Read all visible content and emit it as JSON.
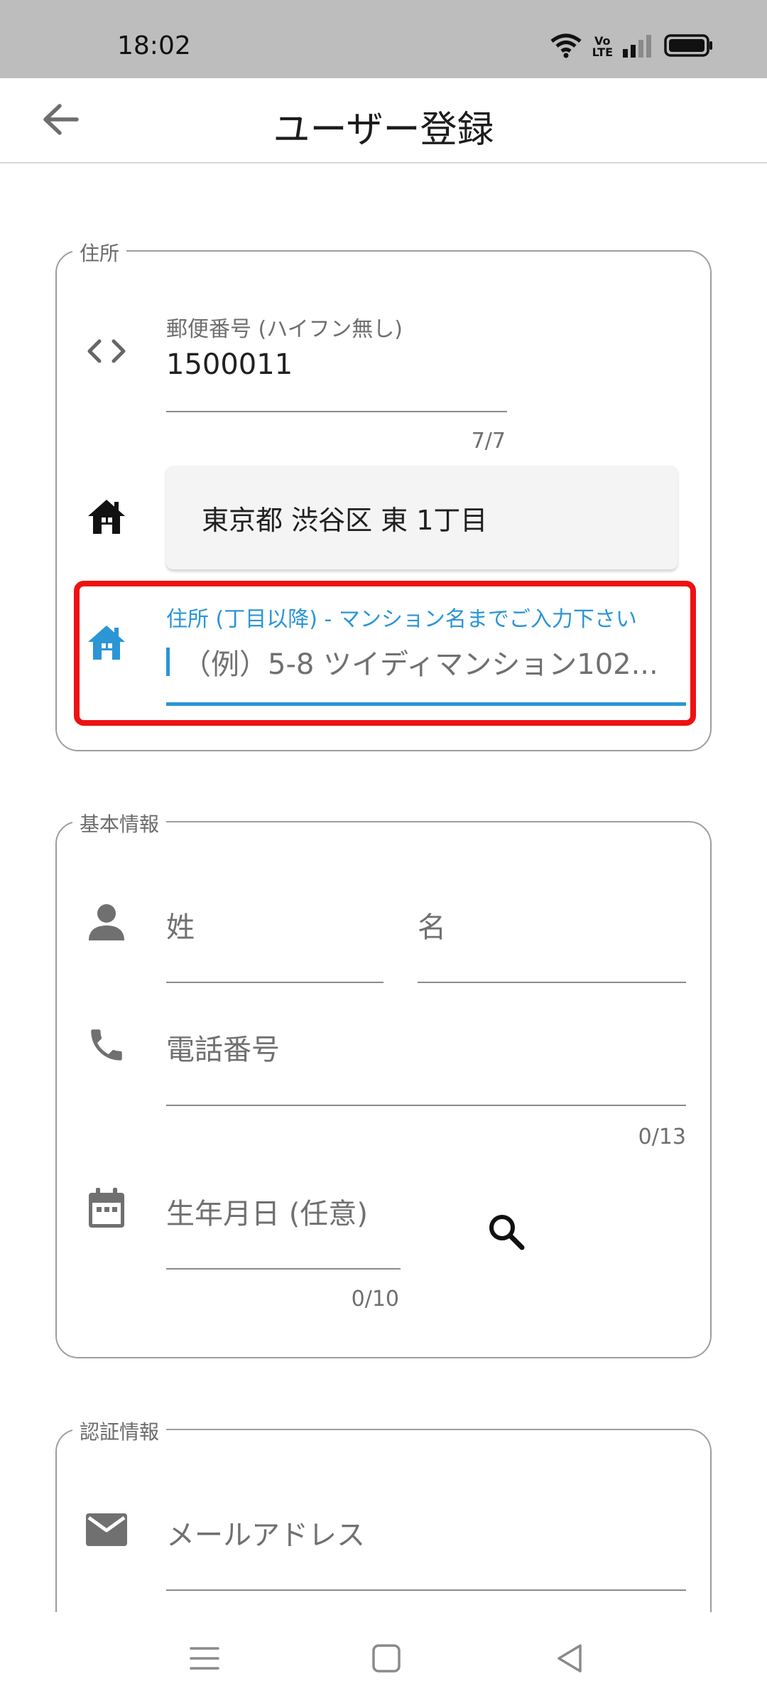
{
  "status_bar": {
    "time": "18:02",
    "volte_top": "Vo",
    "volte_bottom": "LTE",
    "icons": [
      "wifi-icon",
      "volte-icon",
      "signal-icon",
      "battery-icon"
    ]
  },
  "app_bar": {
    "title": "ユーザー登録",
    "back_icon": "arrow-back-icon"
  },
  "address_section": {
    "legend": "住所",
    "postal": {
      "icon": "code-brackets-icon",
      "label": "郵便番号 (ハイフン無し)",
      "value": "1500011",
      "counter": "7/7"
    },
    "prefecture": {
      "icon": "home-icon",
      "value": "東京都 渋谷区 東 1丁目"
    },
    "street": {
      "icon": "home-icon",
      "label": "住所 (丁目以降) - マンション名までご入力下さい",
      "placeholder": "（例）5-8 ツイディマンション102..."
    }
  },
  "basic_section": {
    "legend": "基本情報",
    "last_name_placeholder": "姓",
    "first_name_placeholder": "名",
    "phone_placeholder": "電話番号",
    "phone_counter": "0/13",
    "birthday_placeholder": "生年月日 (任意)",
    "birthday_counter": "0/10",
    "icons": [
      "person-icon",
      "phone-icon",
      "calendar-icon",
      "search-icon"
    ]
  },
  "auth_section": {
    "legend": "認証情報",
    "email_placeholder": "メールアドレス",
    "icon": "email-icon"
  },
  "colors": {
    "accent": "#2b95d6",
    "highlight": "#ee1111",
    "status_bar": "#bdbdbd"
  },
  "nav_bar": {
    "icons": [
      "menu-icon",
      "home-square-icon",
      "back-triangle-icon"
    ]
  }
}
